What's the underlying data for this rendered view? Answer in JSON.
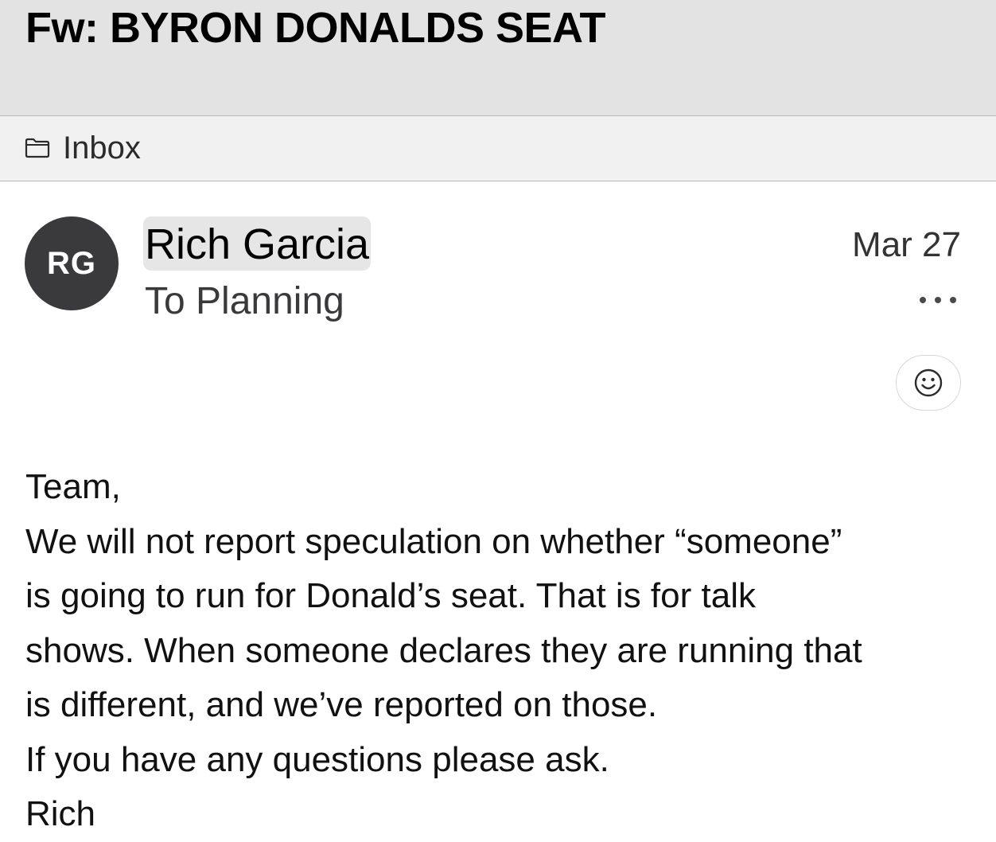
{
  "message": {
    "subject": "Fw: BYRON DONALDS SEAT",
    "mailbox": "Inbox",
    "avatar_initials": "RG",
    "sender": "Rich Garcia",
    "recipient_line": "To Planning",
    "date": "Mar 27",
    "body_lines": [
      "Team,",
      "We will not report speculation on whether “someone”",
      "is going to run for Donald’s seat. That is for talk",
      "shows. When someone declares they are running that",
      "is different, and we’ve reported on those.",
      "If you have any questions please ask.",
      "Rich"
    ]
  },
  "icons": {
    "mailbox": "folder-icon",
    "more": "more-icon",
    "reaction": "smiley-icon"
  },
  "colors": {
    "subject_bar": "#e3e3e3",
    "mailbox_bar": "#f1f1f1",
    "avatar_bg": "#3a3a3c",
    "sender_highlight": "#e6e6e6"
  }
}
